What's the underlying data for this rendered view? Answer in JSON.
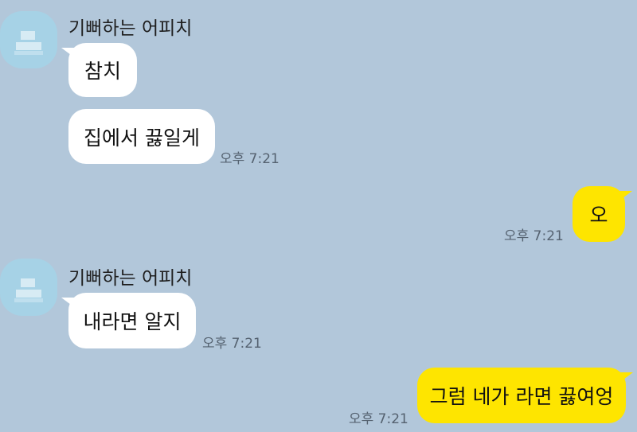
{
  "messages": [
    {
      "sender": "기뻐하는 어피치",
      "bubbles": [
        "참치",
        "집에서 끓일게"
      ],
      "time": "오후 7:21"
    },
    {
      "mine": true,
      "bubbles": [
        "오"
      ],
      "time": "오후 7:21"
    },
    {
      "sender": "기뻐하는 어피치",
      "bubbles": [
        "내라면 알지"
      ],
      "time": "오후 7:21"
    },
    {
      "mine": true,
      "bubbles": [
        "그럼 네가 라면 끓여엉"
      ],
      "time": "오후 7:21"
    }
  ],
  "colors": {
    "background": "#b2c7da",
    "my_bubble": "#fee500",
    "other_bubble": "#ffffff"
  }
}
